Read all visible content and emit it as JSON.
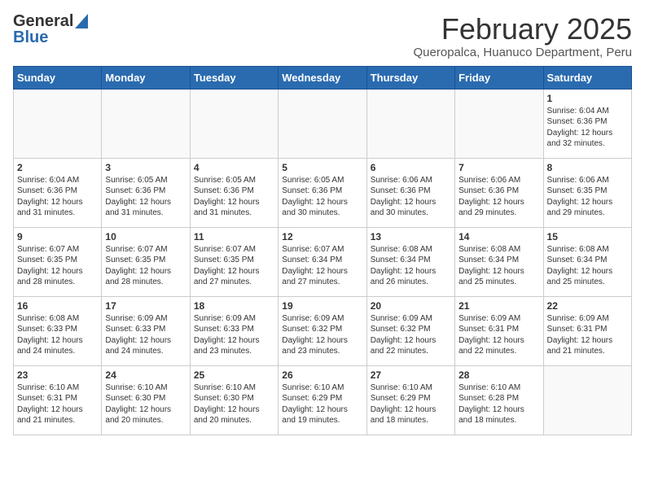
{
  "logo": {
    "general": "General",
    "blue": "Blue"
  },
  "title": "February 2025",
  "location": "Queropalca, Huanuco Department, Peru",
  "days_of_week": [
    "Sunday",
    "Monday",
    "Tuesday",
    "Wednesday",
    "Thursday",
    "Friday",
    "Saturday"
  ],
  "weeks": [
    [
      {
        "day": "",
        "info": ""
      },
      {
        "day": "",
        "info": ""
      },
      {
        "day": "",
        "info": ""
      },
      {
        "day": "",
        "info": ""
      },
      {
        "day": "",
        "info": ""
      },
      {
        "day": "",
        "info": ""
      },
      {
        "day": "1",
        "info": "Sunrise: 6:04 AM\nSunset: 6:36 PM\nDaylight: 12 hours\nand 32 minutes."
      }
    ],
    [
      {
        "day": "2",
        "info": "Sunrise: 6:04 AM\nSunset: 6:36 PM\nDaylight: 12 hours\nand 31 minutes."
      },
      {
        "day": "3",
        "info": "Sunrise: 6:05 AM\nSunset: 6:36 PM\nDaylight: 12 hours\nand 31 minutes."
      },
      {
        "day": "4",
        "info": "Sunrise: 6:05 AM\nSunset: 6:36 PM\nDaylight: 12 hours\nand 31 minutes."
      },
      {
        "day": "5",
        "info": "Sunrise: 6:05 AM\nSunset: 6:36 PM\nDaylight: 12 hours\nand 30 minutes."
      },
      {
        "day": "6",
        "info": "Sunrise: 6:06 AM\nSunset: 6:36 PM\nDaylight: 12 hours\nand 30 minutes."
      },
      {
        "day": "7",
        "info": "Sunrise: 6:06 AM\nSunset: 6:36 PM\nDaylight: 12 hours\nand 29 minutes."
      },
      {
        "day": "8",
        "info": "Sunrise: 6:06 AM\nSunset: 6:35 PM\nDaylight: 12 hours\nand 29 minutes."
      }
    ],
    [
      {
        "day": "9",
        "info": "Sunrise: 6:07 AM\nSunset: 6:35 PM\nDaylight: 12 hours\nand 28 minutes."
      },
      {
        "day": "10",
        "info": "Sunrise: 6:07 AM\nSunset: 6:35 PM\nDaylight: 12 hours\nand 28 minutes."
      },
      {
        "day": "11",
        "info": "Sunrise: 6:07 AM\nSunset: 6:35 PM\nDaylight: 12 hours\nand 27 minutes."
      },
      {
        "day": "12",
        "info": "Sunrise: 6:07 AM\nSunset: 6:34 PM\nDaylight: 12 hours\nand 27 minutes."
      },
      {
        "day": "13",
        "info": "Sunrise: 6:08 AM\nSunset: 6:34 PM\nDaylight: 12 hours\nand 26 minutes."
      },
      {
        "day": "14",
        "info": "Sunrise: 6:08 AM\nSunset: 6:34 PM\nDaylight: 12 hours\nand 25 minutes."
      },
      {
        "day": "15",
        "info": "Sunrise: 6:08 AM\nSunset: 6:34 PM\nDaylight: 12 hours\nand 25 minutes."
      }
    ],
    [
      {
        "day": "16",
        "info": "Sunrise: 6:08 AM\nSunset: 6:33 PM\nDaylight: 12 hours\nand 24 minutes."
      },
      {
        "day": "17",
        "info": "Sunrise: 6:09 AM\nSunset: 6:33 PM\nDaylight: 12 hours\nand 24 minutes."
      },
      {
        "day": "18",
        "info": "Sunrise: 6:09 AM\nSunset: 6:33 PM\nDaylight: 12 hours\nand 23 minutes."
      },
      {
        "day": "19",
        "info": "Sunrise: 6:09 AM\nSunset: 6:32 PM\nDaylight: 12 hours\nand 23 minutes."
      },
      {
        "day": "20",
        "info": "Sunrise: 6:09 AM\nSunset: 6:32 PM\nDaylight: 12 hours\nand 22 minutes."
      },
      {
        "day": "21",
        "info": "Sunrise: 6:09 AM\nSunset: 6:31 PM\nDaylight: 12 hours\nand 22 minutes."
      },
      {
        "day": "22",
        "info": "Sunrise: 6:09 AM\nSunset: 6:31 PM\nDaylight: 12 hours\nand 21 minutes."
      }
    ],
    [
      {
        "day": "23",
        "info": "Sunrise: 6:10 AM\nSunset: 6:31 PM\nDaylight: 12 hours\nand 21 minutes."
      },
      {
        "day": "24",
        "info": "Sunrise: 6:10 AM\nSunset: 6:30 PM\nDaylight: 12 hours\nand 20 minutes."
      },
      {
        "day": "25",
        "info": "Sunrise: 6:10 AM\nSunset: 6:30 PM\nDaylight: 12 hours\nand 20 minutes."
      },
      {
        "day": "26",
        "info": "Sunrise: 6:10 AM\nSunset: 6:29 PM\nDaylight: 12 hours\nand 19 minutes."
      },
      {
        "day": "27",
        "info": "Sunrise: 6:10 AM\nSunset: 6:29 PM\nDaylight: 12 hours\nand 18 minutes."
      },
      {
        "day": "28",
        "info": "Sunrise: 6:10 AM\nSunset: 6:28 PM\nDaylight: 12 hours\nand 18 minutes."
      },
      {
        "day": "",
        "info": ""
      }
    ]
  ]
}
